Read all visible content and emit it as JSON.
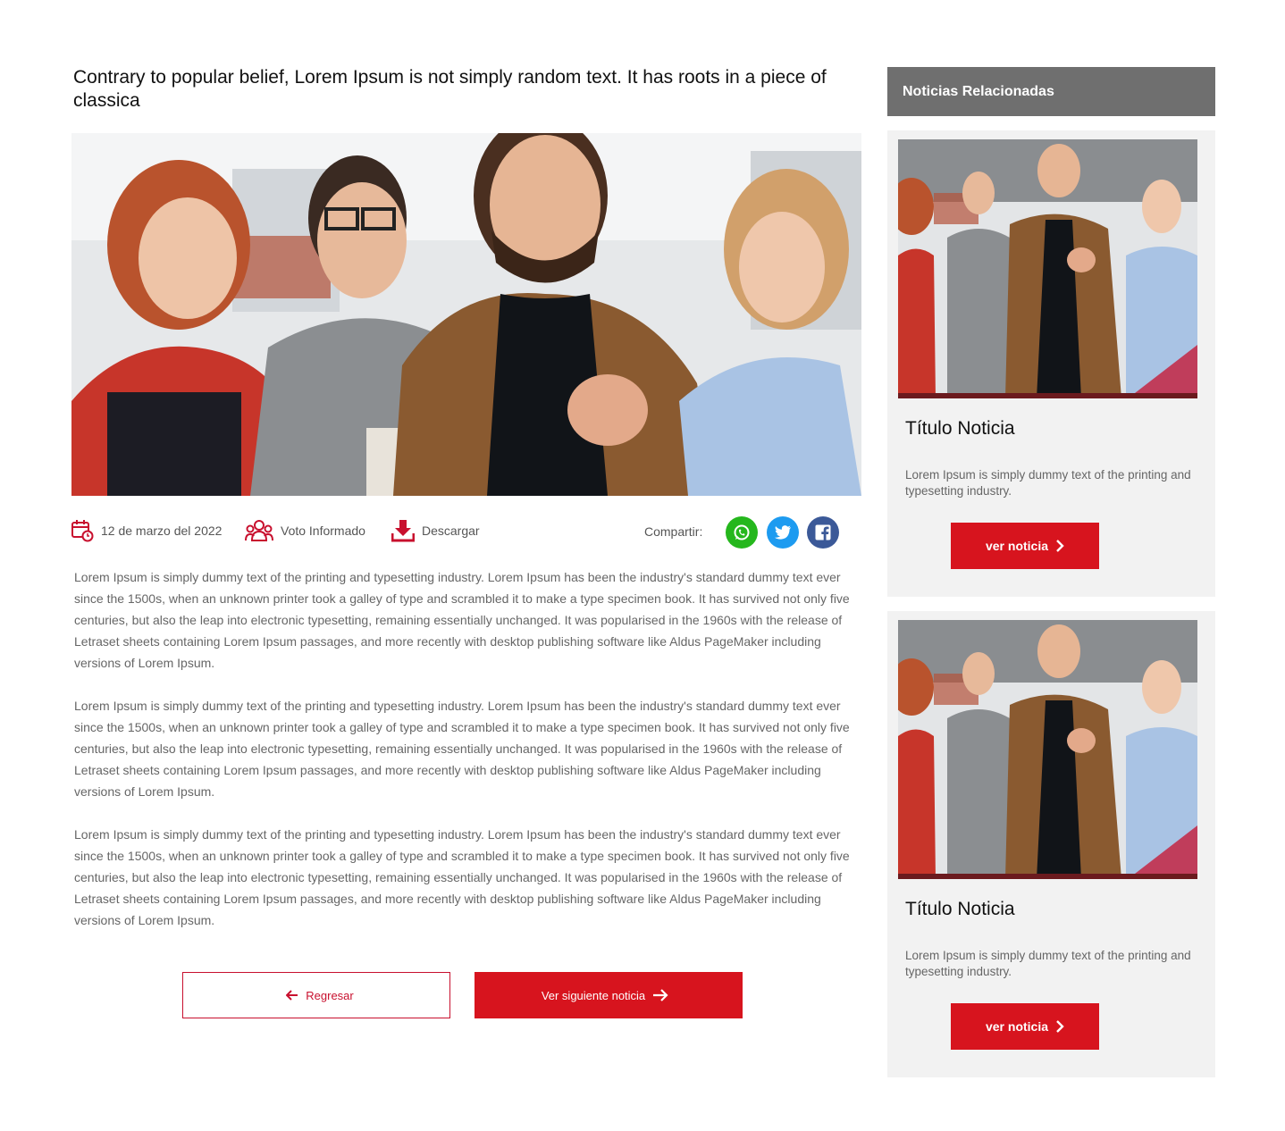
{
  "article": {
    "title": "Contrary to popular belief, Lorem Ipsum is not simply random text. It has roots in a piece of classica",
    "hero_image": "group-of-coworkers-photo",
    "meta": {
      "date": "12 de marzo del 2022",
      "category": "Voto Informado",
      "download_label": "Descargar",
      "share_label": "Compartir:"
    },
    "share": [
      {
        "name": "whatsapp-icon",
        "color": "#25b71d"
      },
      {
        "name": "twitter-icon",
        "color": "#1d9bf0"
      },
      {
        "name": "facebook-icon",
        "color": "#3b5998"
      }
    ],
    "paragraphs": [
      "Lorem Ipsum is simply dummy text of the printing and typesetting industry. Lorem Ipsum has been the industry's standard dummy text ever since the 1500s, when an unknown printer took a galley of type and scrambled it to make a type specimen book. It has survived not only five centuries, but also the leap into electronic typesetting, remaining essentially unchanged. It was popularised in the 1960s with the release of Letraset sheets containing Lorem Ipsum passages, and more recently with desktop publishing software like Aldus PageMaker including versions of Lorem Ipsum.",
      "Lorem Ipsum is simply dummy text of the printing and typesetting industry. Lorem Ipsum has been the industry's standard dummy text ever since the 1500s, when an unknown printer took a galley of type and scrambled it to make a type specimen book. It has survived not only five centuries, but also the leap into electronic typesetting, remaining essentially unchanged. It was popularised in the 1960s with the release of Letraset sheets containing Lorem Ipsum passages, and more recently with desktop publishing software like Aldus PageMaker including versions of Lorem Ipsum.",
      "Lorem Ipsum is simply dummy text of the printing and typesetting industry. Lorem Ipsum has been the industry's standard dummy text ever since the 1500s, when an unknown printer took a galley of type and scrambled it to make a type specimen book. It has survived not only five centuries, but also the leap into electronic typesetting, remaining essentially unchanged. It was popularised in the 1960s with the release of Letraset sheets containing Lorem Ipsum passages, and more recently with desktop publishing software like Aldus PageMaker including versions of Lorem Ipsum."
    ],
    "buttons": {
      "back_label": "Regresar",
      "next_label": "Ver siguiente noticia"
    }
  },
  "sidebar": {
    "header": "Noticias Relacionadas",
    "cards": [
      {
        "title": "Título Noticia",
        "text": "Lorem Ipsum is simply dummy text of the printing and typesetting industry.",
        "button": "ver noticia"
      },
      {
        "title": "Título Noticia",
        "text": "Lorem Ipsum is simply dummy text of the printing and typesetting industry.",
        "button": "ver noticia"
      }
    ]
  },
  "colors": {
    "accent_red": "#d7141e",
    "sidebar_header": "#6f6f6f",
    "card_bg": "#f2f2f2"
  }
}
